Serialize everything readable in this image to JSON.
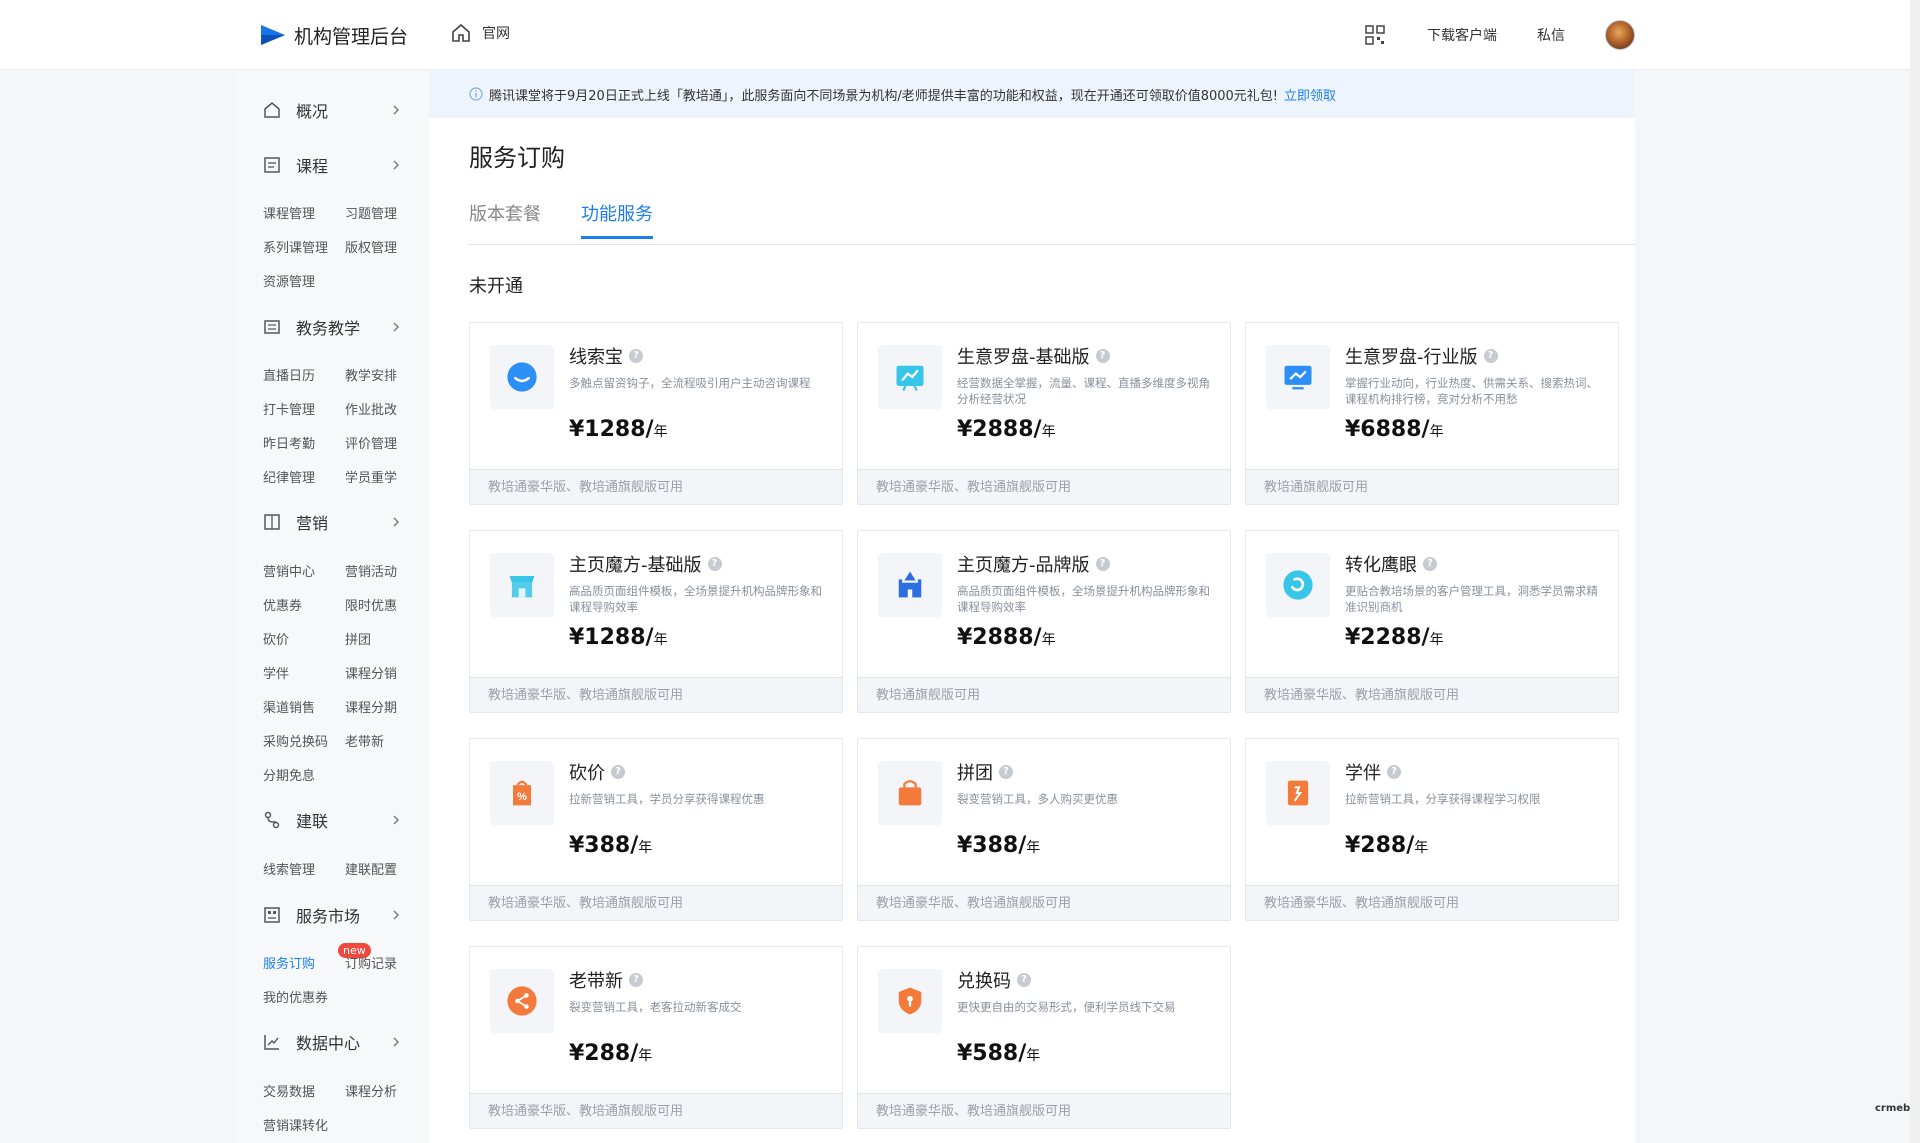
{
  "header": {
    "title": "机构管理后台",
    "home_label": "官网",
    "download_label": "下载客户端",
    "message_label": "私信"
  },
  "sidebar": {
    "sections": [
      {
        "label": "概况",
        "icon": "home-icon",
        "subs": []
      },
      {
        "label": "课程",
        "icon": "course-icon",
        "subs": [
          "课程管理",
          "习题管理",
          "系列课管理",
          "版权管理",
          "资源管理"
        ]
      },
      {
        "label": "教务教学",
        "icon": "teaching-icon",
        "subs": [
          "直播日历",
          "教学安排",
          "打卡管理",
          "作业批改",
          "昨日考勤",
          "评价管理",
          "纪律管理",
          "学员重学"
        ]
      },
      {
        "label": "营销",
        "icon": "marketing-icon",
        "subs": [
          "营销中心",
          "营销活动",
          "优惠券",
          "限时优惠",
          "砍价",
          "拼团",
          "学伴",
          "课程分销",
          "渠道销售",
          "课程分期",
          "采购兑换码",
          "老带新",
          "分期免息"
        ]
      },
      {
        "label": "建联",
        "icon": "connect-icon",
        "subs": [
          "线索管理",
          "建联配置"
        ]
      },
      {
        "label": "服务市场",
        "icon": "market-icon",
        "subs": [
          "服务订购",
          "订购记录",
          "我的优惠券"
        ]
      },
      {
        "label": "数据中心",
        "icon": "chart-icon",
        "subs": [
          "交易数据",
          "课程分析",
          "营销课转化"
        ]
      }
    ],
    "new_badge": "new"
  },
  "notice": {
    "text": "腾讯课堂将于9月20日正式上线「教培通」，此服务面向不同场景为机构/老师提供丰富的功能和权益，现在开通还可领取价值8000元礼包!",
    "link": "立即领取"
  },
  "page": {
    "title": "服务订购",
    "tabs": [
      "版本套餐",
      "功能服务"
    ],
    "active_tab": 1,
    "section_title": "未开通"
  },
  "cards": [
    {
      "name": "线索宝",
      "desc": "多触点留资钩子，全流程吸引用户主动咨询课程",
      "price": "¥1288/",
      "unit": "年",
      "foot": "教培通豪华版、教培通旗舰版可用",
      "icon": "chat-bubble-icon",
      "color": "#2b8ff5"
    },
    {
      "name": "生意罗盘-基础版",
      "desc": "经营数据全掌握，流量、课程、直播多维度多视角分析经营状况",
      "price": "¥2888/",
      "unit": "年",
      "foot": "教培通豪华版、教培通旗舰版可用",
      "icon": "compass-icon",
      "color": "#38c6e8"
    },
    {
      "name": "生意罗盘-行业版",
      "desc": "掌握行业动向，行业热度、供需关系、搜索热词、课程机构排行榜，竞对分析不用愁",
      "price": "¥6888/",
      "unit": "年",
      "foot": "教培通旗舰版可用",
      "icon": "monitor-icon",
      "color": "#2b8ff5"
    },
    {
      "name": "主页魔方-基础版",
      "desc": "高品质页面组件模板，全场景提升机构品牌形象和课程导购效率",
      "price": "¥1288/",
      "unit": "年",
      "foot": "教培通豪华版、教培通旗舰版可用",
      "icon": "store-icon",
      "color": "#38c6e8"
    },
    {
      "name": "主页魔方-品牌版",
      "desc": "高品质页面组件模板，全场景提升机构品牌形象和课程导购效率",
      "price": "¥2888/",
      "unit": "年",
      "foot": "教培通旗舰版可用",
      "icon": "castle-icon",
      "color": "#2b6fe0"
    },
    {
      "name": "转化鹰眼",
      "desc": "更贴合教培场景的客户管理工具，洞悉学员需求精准识别商机",
      "price": "¥2288/",
      "unit": "年",
      "foot": "教培通豪华版、教培通旗舰版可用",
      "icon": "eye-icon",
      "color": "#38c6e8"
    },
    {
      "name": "砍价",
      "desc": "拉新营销工具，学员分享获得课程优惠",
      "price": "¥388/",
      "unit": "年",
      "foot": "教培通豪华版、教培通旗舰版可用",
      "icon": "price-tag-icon",
      "color": "#f47a3b"
    },
    {
      "name": "拼团",
      "desc": "裂变营销工具，多人购买更优惠",
      "price": "¥388/",
      "unit": "年",
      "foot": "教培通豪华版、教培通旗舰版可用",
      "icon": "shopping-bag-icon",
      "color": "#f47a3b"
    },
    {
      "name": "学伴",
      "desc": "拉新营销工具，分享获得课程学习权限",
      "price": "¥288/",
      "unit": "年",
      "foot": "教培通豪华版、教培通旗舰版可用",
      "icon": "book-icon",
      "color": "#f47a3b"
    },
    {
      "name": "老带新",
      "desc": "裂变营销工具，老客拉动新客成交",
      "price": "¥288/",
      "unit": "年",
      "foot": "教培通豪华版、教培通旗舰版可用",
      "icon": "share-icon",
      "color": "#f47a3b"
    },
    {
      "name": "兑换码",
      "desc": "更快更自由的交易形式，便利学员线下交易",
      "price": "¥588/",
      "unit": "年",
      "foot": "教培通豪华版、教培通旗舰版可用",
      "icon": "shield-icon",
      "color": "#f47a3b"
    }
  ],
  "watermark": "crmeb"
}
